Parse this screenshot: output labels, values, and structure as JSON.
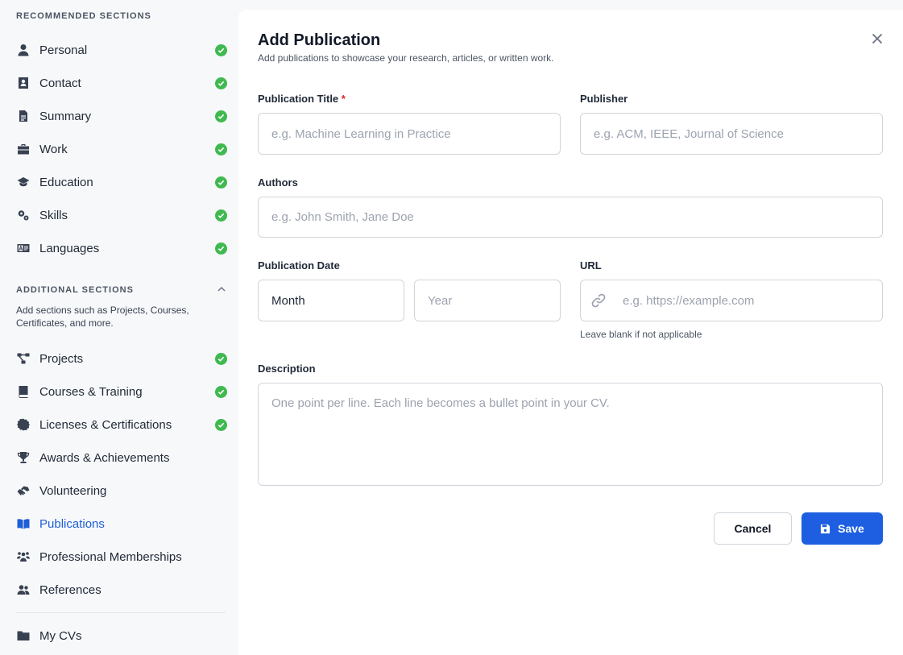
{
  "sidebar": {
    "recommended_heading": "RECOMMENDED SECTIONS",
    "recommended_items": [
      {
        "label": "Personal",
        "icon": "user-icon",
        "completed": true
      },
      {
        "label": "Contact",
        "icon": "contact-card-icon",
        "completed": true
      },
      {
        "label": "Summary",
        "icon": "document-icon",
        "completed": true
      },
      {
        "label": "Work",
        "icon": "briefcase-icon",
        "completed": true
      },
      {
        "label": "Education",
        "icon": "graduation-cap-icon",
        "completed": true
      },
      {
        "label": "Skills",
        "icon": "gears-icon",
        "completed": true
      },
      {
        "label": "Languages",
        "icon": "language-icon",
        "completed": true
      }
    ],
    "additional_heading": "ADDITIONAL SECTIONS",
    "additional_description": "Add sections such as Projects, Courses, Certificates, and more.",
    "additional_items": [
      {
        "label": "Projects",
        "icon": "project-diagram-icon",
        "completed": true
      },
      {
        "label": "Courses & Training",
        "icon": "book-icon",
        "completed": true
      },
      {
        "label": "Licenses & Certifications",
        "icon": "certificate-icon",
        "completed": true
      },
      {
        "label": "Awards & Achievements",
        "icon": "trophy-icon",
        "completed": false
      },
      {
        "label": "Volunteering",
        "icon": "hands-helping-icon",
        "completed": false
      },
      {
        "label": "Publications",
        "icon": "open-book-icon",
        "completed": false,
        "active": true
      },
      {
        "label": "Professional Memberships",
        "icon": "users-group-icon",
        "completed": false
      },
      {
        "label": "References",
        "icon": "users-icon",
        "completed": false
      }
    ],
    "footer_item": {
      "label": "My CVs",
      "icon": "folder-icon"
    }
  },
  "modal": {
    "title": "Add Publication",
    "subtitle": "Add publications to showcase your research, articles, or written work.",
    "fields": {
      "publication_title": {
        "label": "Publication Title",
        "required_mark": "*",
        "placeholder": "e.g. Machine Learning in Practice"
      },
      "publisher": {
        "label": "Publisher",
        "placeholder": "e.g. ACM, IEEE, Journal of Science"
      },
      "authors": {
        "label": "Authors",
        "placeholder": "e.g. John Smith, Jane Doe"
      },
      "publication_date": {
        "label": "Publication Date",
        "month_value": "Month",
        "year_placeholder": "Year"
      },
      "url": {
        "label": "URL",
        "placeholder": "e.g. https://example.com",
        "helper": "Leave blank if not applicable"
      },
      "description": {
        "label": "Description",
        "placeholder": "One point per line. Each line becomes a bullet point in your CV."
      }
    },
    "buttons": {
      "cancel": "Cancel",
      "save": "Save"
    }
  },
  "colors": {
    "accent": "#1d5fe0",
    "active_nav": "#1d5fd6",
    "check": "#3fb950",
    "required": "#dc2626"
  }
}
